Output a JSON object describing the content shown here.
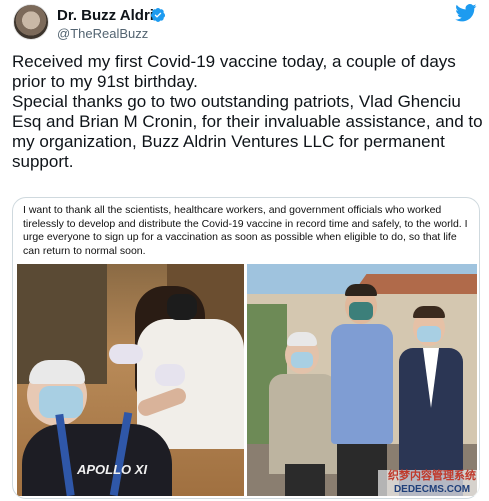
{
  "header": {
    "display_name": "Dr. Buzz Aldrin",
    "handle": "@TheRealBuzz"
  },
  "tweet": {
    "line_1": "Received my first Covid-19 vaccine today, a couple of days prior to my 91st birthday.",
    "line_2": "Special thanks go to two outstanding patriots, Vlad Ghenciu Esq and Brian M Cronin, for their invaluable assistance, and to my organization, Buzz Aldrin Ventures LLC for permanent support."
  },
  "media": {
    "statement": "I want to thank all the scientists, healthcare workers, and government officials who worked tirelessly to develop and distribute the Covid-19 vaccine in record time and safely, to the world.  I urge everyone to sign up for a vaccination as soon as possible when eligible to do, so that life can return to normal soon.",
    "shirt_text": "APOLLO XI"
  },
  "watermark": {
    "line_1": "织梦内容管理系统",
    "line_2": "DEDECMS.COM"
  },
  "colors": {
    "twitter_blue": "#1d9bf0",
    "text": "#0f1419",
    "secondary": "#536471",
    "border": "#cfd9de"
  },
  "icons": {
    "verified": "verified-badge-icon",
    "logo": "twitter-bird-icon"
  }
}
